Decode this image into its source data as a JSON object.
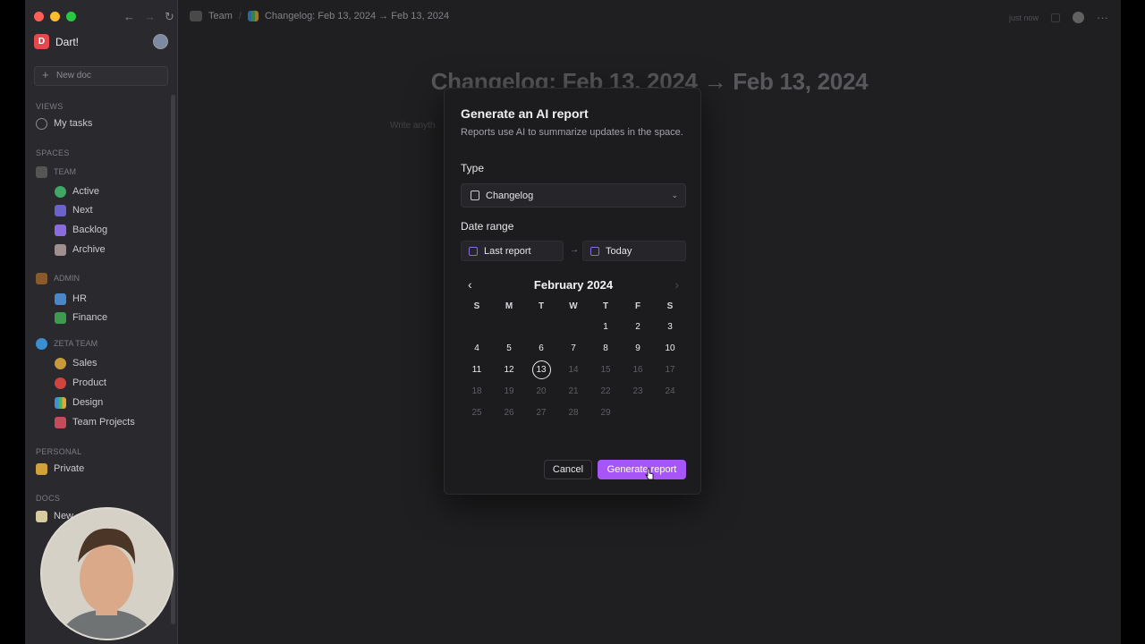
{
  "sidebar": {
    "workspace": "Dart!",
    "new_doc": "New doc",
    "views_label": "VIEWS",
    "my_tasks": "My tasks",
    "spaces_label": "SPACES",
    "team_label": "TEAM",
    "team_items": [
      "Active",
      "Next",
      "Backlog",
      "Archive"
    ],
    "admin_label": "ADMIN",
    "admin_items": [
      "HR",
      "Finance"
    ],
    "zeta_label": "ZETA TEAM",
    "zeta_items": [
      "Sales",
      "Product",
      "Design",
      "Team Projects"
    ],
    "personal_label": "PERSONAL",
    "private": "Private",
    "docs_label": "DOCS",
    "docs_item": "New"
  },
  "topbar": {
    "crumb_team": "Team",
    "crumb_sep": "/",
    "crumb_doc": "Changelog: Feb 13, 2024 → Feb 13, 2024",
    "timestamp": "just now"
  },
  "document": {
    "title": "Changelog: Feb 13, 2024 → Feb 13, 2024",
    "placeholder": "Write anyth"
  },
  "modal": {
    "title": "Generate an AI report",
    "subtitle": "Reports use AI to summarize updates in the space.",
    "type_label": "Type",
    "type_value": "Changelog",
    "date_label": "Date range",
    "date_from": "Last report",
    "date_to": "Today",
    "calendar": {
      "month": "February 2024",
      "dow": [
        "S",
        "M",
        "T",
        "W",
        "T",
        "F",
        "S"
      ],
      "selected": "13"
    },
    "cancel": "Cancel",
    "generate": "Generate report"
  }
}
